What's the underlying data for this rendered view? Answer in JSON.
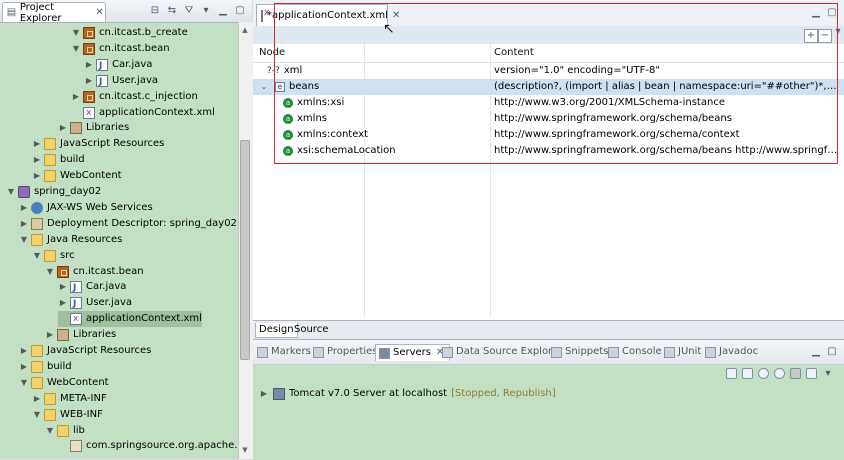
{
  "explorer": {
    "title": "Project Explorer",
    "items": [
      {
        "label": "cn.itcast.b_create",
        "icon": "package-icon",
        "twisty": "expanded"
      },
      {
        "label": "cn.itcast.bean",
        "icon": "package-icon",
        "twisty": "expanded"
      },
      {
        "label": "Car.java",
        "icon": "java-file-icon",
        "twisty": "collapsed"
      },
      {
        "label": "User.java",
        "icon": "java-file-icon",
        "twisty": "collapsed"
      },
      {
        "label": "cn.itcast.c_injection",
        "icon": "package-icon",
        "twisty": "collapsed"
      },
      {
        "label": "applicationContext.xml",
        "icon": "xml-file-icon",
        "twisty": "none"
      },
      {
        "label": "Libraries",
        "icon": "library-icon",
        "twisty": "collapsed"
      },
      {
        "label": "JavaScript Resources",
        "icon": "folder-icon",
        "twisty": "collapsed"
      },
      {
        "label": "build",
        "icon": "folder-icon",
        "twisty": "collapsed"
      },
      {
        "label": "WebContent",
        "icon": "folder-icon",
        "twisty": "collapsed"
      },
      {
        "label": "spring_day02",
        "icon": "project-icon",
        "twisty": "expanded"
      },
      {
        "label": "JAX-WS Web Services",
        "icon": "web-services-icon",
        "twisty": "collapsed"
      },
      {
        "label": "Deployment Descriptor: spring_day02",
        "icon": "deployment-descriptor-icon",
        "twisty": "collapsed"
      },
      {
        "label": "Java Resources",
        "icon": "folder-icon",
        "twisty": "expanded"
      },
      {
        "label": "src",
        "icon": "source-folder-icon",
        "twisty": "expanded"
      },
      {
        "label": "cn.itcast.bean",
        "icon": "package-icon",
        "twisty": "expanded"
      },
      {
        "label": "Car.java",
        "icon": "java-file-icon",
        "twisty": "collapsed"
      },
      {
        "label": "User.java",
        "icon": "java-file-icon",
        "twisty": "collapsed"
      },
      {
        "label": "applicationContext.xml",
        "icon": "xml-file-icon",
        "twisty": "none",
        "selected": true
      },
      {
        "label": "Libraries",
        "icon": "library-icon",
        "twisty": "collapsed"
      },
      {
        "label": "JavaScript Resources",
        "icon": "folder-icon",
        "twisty": "collapsed"
      },
      {
        "label": "build",
        "icon": "folder-icon",
        "twisty": "collapsed"
      },
      {
        "label": "WebContent",
        "icon": "folder-icon",
        "twisty": "expanded"
      },
      {
        "label": "META-INF",
        "icon": "folder-icon",
        "twisty": "collapsed"
      },
      {
        "label": "WEB-INF",
        "icon": "folder-icon",
        "twisty": "expanded"
      },
      {
        "label": "lib",
        "icon": "folder-icon",
        "twisty": "expanded"
      },
      {
        "label": "com.springsource.org.apache.comm",
        "icon": "jar-icon",
        "twisty": "none"
      }
    ]
  },
  "editor": {
    "tab_label": "*applicationContext.xml",
    "columns": {
      "node": "Node",
      "content": "Content"
    },
    "rows": [
      {
        "node": "xml",
        "content": "version=\"1.0\" encoding=\"UTF-8\"",
        "icon": "processing-instruction-icon"
      },
      {
        "node": "beans",
        "content": "(description?, (import | alias | bean | namespace:uri=\"##other\")*, beans*)",
        "icon": "element-icon",
        "selected": true
      },
      {
        "node": "xmlns:xsi",
        "content": "http://www.w3.org/2001/XMLSchema-instance",
        "icon": "attribute-icon"
      },
      {
        "node": "xmlns",
        "content": "http://www.springframework.org/schema/beans",
        "icon": "attribute-icon"
      },
      {
        "node": "xmlns:context",
        "content": "http://www.springframework.org/schema/context",
        "icon": "attribute-icon"
      },
      {
        "node": "xsi:schemaLocation",
        "content": "http://www.springframework.org/schema/beans http://www.springframework.org...",
        "icon": "attribute-icon"
      }
    ],
    "bottom_tabs": [
      "Design",
      "Source"
    ],
    "active_bottom_tab": "Design"
  },
  "servers_view": {
    "tabs": [
      "Markers",
      "Properties",
      "Servers",
      "Data Source Explorer",
      "Snippets",
      "Console",
      "JUnit",
      "Javadoc"
    ],
    "active_tab": "Servers",
    "server": {
      "name": "Tomcat v7.0 Server at localhost",
      "status": "[Stopped, Republish]"
    }
  },
  "colors": {
    "explorer_bg": "#c4e0c4",
    "selection_green": "#9fbf9f",
    "selection_blue": "#cde0f4",
    "highlight_box": "#d9272e"
  }
}
